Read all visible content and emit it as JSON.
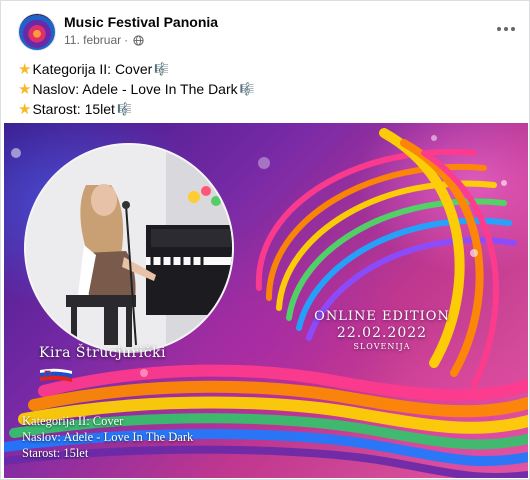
{
  "post": {
    "page_name": "Music Festival Panonia",
    "date": "11. februar",
    "separator": "·",
    "lines": [
      {
        "text": "Kategorija II: Cover"
      },
      {
        "text": "Naslov: Adele - Love In The Dark"
      },
      {
        "text": "Starost: 15let"
      }
    ]
  },
  "image": {
    "performer_name": "Kira Štrucjurički",
    "edition_title": "ONLINE EDITION",
    "edition_date": "22.02.2022",
    "edition_country": "SLOVENIJA",
    "caption_lines": [
      "Kategorija II: Cover",
      "Naslov: Adele - Love In The Dark",
      "Starost: 15let"
    ]
  },
  "icons": {
    "line_prefix": "star-icon",
    "line_suffix": "music-note-icon",
    "privacy": "globe-icon",
    "menu": "more-options-icon",
    "flag": "slovenia-flag-icon"
  },
  "colors": {
    "page_name": "#050505",
    "meta": "#65676b",
    "star": "#f7b928",
    "background_purple": "#7a2aa6",
    "background_pink": "#e05a9e"
  }
}
